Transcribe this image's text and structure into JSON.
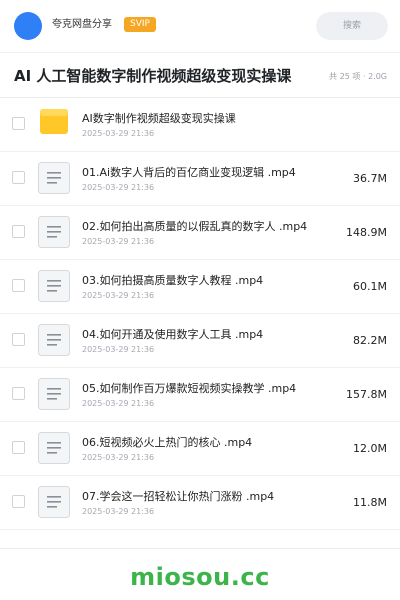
{
  "header": {
    "brand": "夸克网盘分享",
    "badge": "SVIP",
    "search_placeholder": "搜索",
    "accent_color": "#2f80f6",
    "badge_color": "#f5a623"
  },
  "folder": {
    "title": "AI 人工智能数字制作视频超级变现实操课",
    "meta": "共 25 项 · 2.0G"
  },
  "files": [
    {
      "type": "folder",
      "icon": "folder-icon",
      "name": "AI数字制作视频超级变现实操课",
      "date": "2025-03-29 21:36",
      "size": ""
    },
    {
      "type": "video",
      "icon": "file-icon",
      "name": "01.Ai数字人背后的百亿商业变现逻辑 .mp4",
      "date": "2025-03-29 21:36",
      "size": "36.7M"
    },
    {
      "type": "video",
      "icon": "file-icon",
      "name": "02.如何拍出高质量的以假乱真的数字人 .mp4",
      "date": "2025-03-29 21:36",
      "size": "148.9M"
    },
    {
      "type": "video",
      "icon": "file-icon",
      "name": "03.如何拍摄高质量数字人教程 .mp4",
      "date": "2025-03-29 21:36",
      "size": "60.1M"
    },
    {
      "type": "video",
      "icon": "file-icon",
      "name": "04.如何开通及使用数字人工具 .mp4",
      "date": "2025-03-29 21:36",
      "size": "82.2M"
    },
    {
      "type": "video",
      "icon": "file-icon",
      "name": "05.如何制作百万爆款短视频实操教学 .mp4",
      "date": "2025-03-29 21:36",
      "size": "157.8M"
    },
    {
      "type": "video",
      "icon": "file-icon",
      "name": "06.短视频必火上热门的核心 .mp4",
      "date": "2025-03-29 21:36",
      "size": "12.0M"
    },
    {
      "type": "video",
      "icon": "file-icon",
      "name": "07.学会这一招轻松让你热门涨粉 .mp4",
      "date": "2025-03-29 21:36",
      "size": "11.8M"
    }
  ],
  "watermark": "miosou.cc",
  "watermark_color": "#3bb54a"
}
